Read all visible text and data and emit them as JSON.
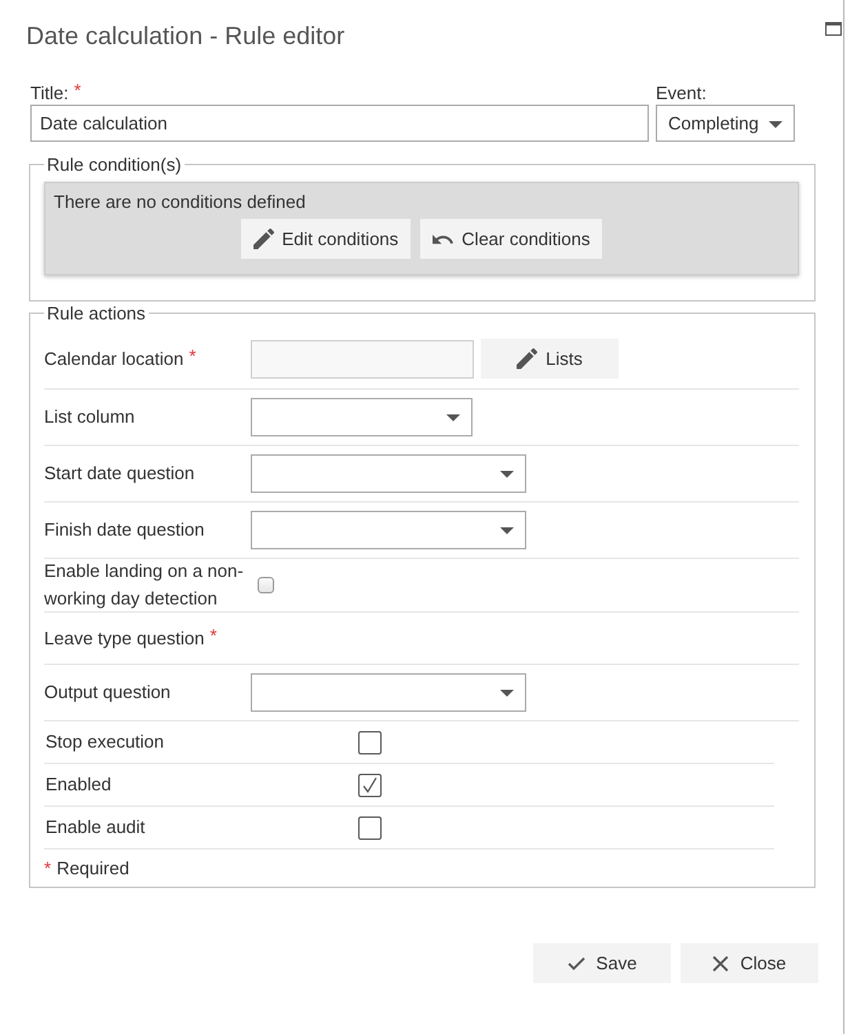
{
  "window": {
    "title": "Date calculation - Rule editor"
  },
  "title_field": {
    "label": "Title:",
    "required_mark": "*",
    "value": "Date calculation"
  },
  "event_field": {
    "label": "Event:",
    "value": "Completing"
  },
  "conditions": {
    "legend": "Rule condition(s)",
    "message": "There are no conditions defined",
    "buttons": [
      {
        "kind": "edit",
        "label": "Edit conditions"
      },
      {
        "kind": "undo",
        "label": "Clear conditions"
      }
    ]
  },
  "actions": {
    "legend": "Rule actions",
    "rows": [
      {
        "kind": "lookup",
        "label": "Calendar location",
        "required_mark": "*",
        "button": {
          "kind": "edit",
          "label": "Lists"
        }
      },
      {
        "kind": "short-select",
        "label": "List column"
      },
      {
        "kind": "select",
        "label": "Start date question"
      },
      {
        "kind": "select",
        "label": "Finish date question"
      },
      {
        "kind": "small-checkbox",
        "label": "Enable landing on a non-working day detection",
        "checked": false
      },
      {
        "kind": "label",
        "label": "Leave type question",
        "required_mark": "*"
      },
      {
        "kind": "select",
        "label": "Output question"
      },
      {
        "kind": "checkbox",
        "label": "Stop execution",
        "checked": false
      },
      {
        "kind": "checkbox",
        "label": "Enabled",
        "checked": true
      },
      {
        "kind": "checkbox",
        "label": "Enable audit",
        "checked": false
      }
    ],
    "note": {
      "mark": "*",
      "text": "Required"
    }
  },
  "footer_buttons": [
    {
      "kind": "save",
      "label": "Save"
    },
    {
      "kind": "close",
      "label": "Close"
    }
  ]
}
